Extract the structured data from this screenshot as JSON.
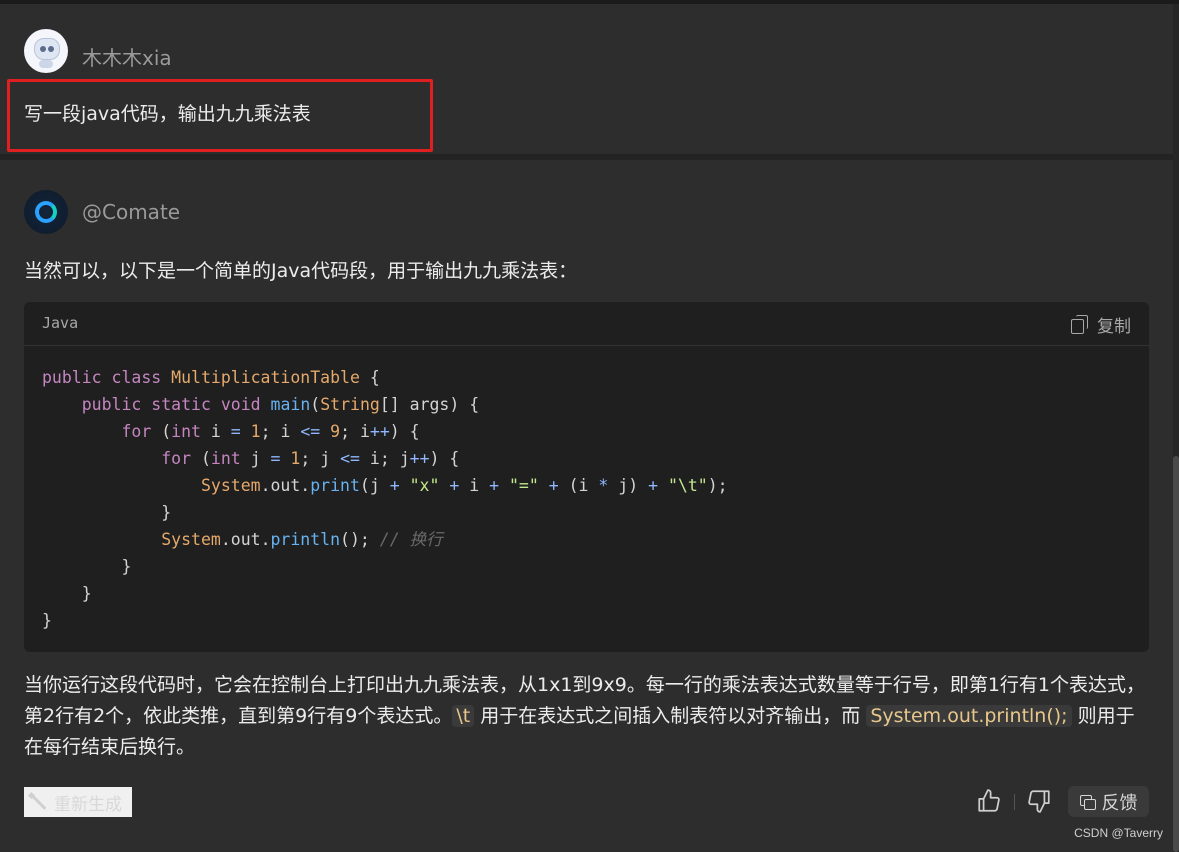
{
  "user": {
    "name": "木木木xia",
    "message": "写一段java代码，输出九九乘法表"
  },
  "bot": {
    "name": "@Comate",
    "intro": "当然可以，以下是一个简单的Java代码段，用于输出九九乘法表：",
    "code_block": {
      "language": "Java",
      "copy_label": "复制",
      "lines": [
        "public class MultiplicationTable {",
        "    public static void main(String[] args) {",
        "        for (int i = 1; i <= 9; i++) {",
        "            for (int j = 1; j <= i; j++) {",
        "                System.out.print(j + \"x\" + i + \"=\" + (i * j) + \"\\t\");",
        "            }",
        "            System.out.println(); // 换行",
        "        }",
        "    }",
        "}"
      ]
    },
    "explanation": {
      "part1": "当你运行这段代码时，它会在控制台上打印出九九乘法表，从1x1到9x9。每一行的乘法表达式数量等于行号，即第1行有1个表达式，第2行有2个，依此类推，直到第9行有9个表达式。",
      "code1": "\\t",
      "part2": "用于在表达式之间插入制表符以对齐输出，而",
      "code2": "System.out.println();",
      "part3": "则用于在每行结束后换行。"
    }
  },
  "actions": {
    "regenerate_label": "重新生成",
    "like_icon": "thumbs-up-icon",
    "dislike_icon": "thumbs-down-icon",
    "feedback_label": "反馈"
  },
  "watermark": "CSDN @Taverry",
  "colors": {
    "background": "#2b2b2b",
    "highlight_border": "#e02020",
    "code_background": "#1f1f1f"
  }
}
